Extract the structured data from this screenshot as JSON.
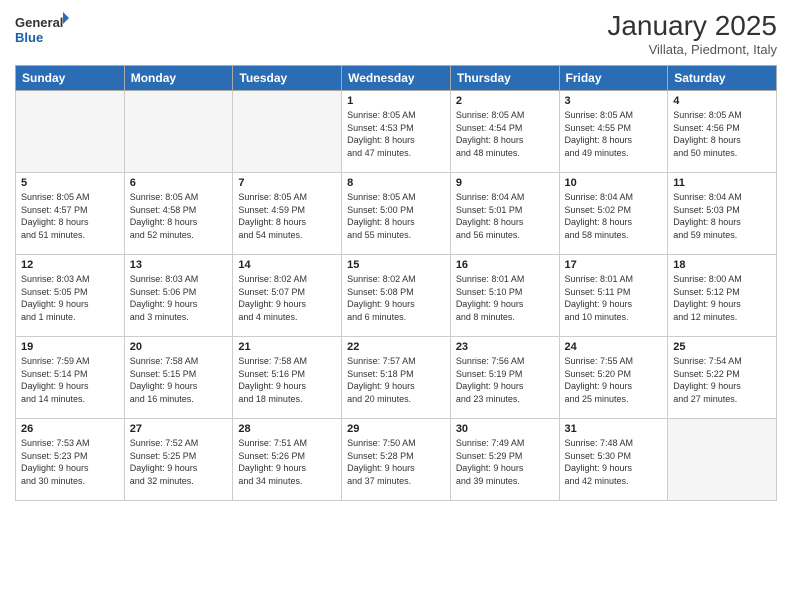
{
  "logo": {
    "general": "General",
    "blue": "Blue"
  },
  "header": {
    "title": "January 2025",
    "location": "Villata, Piedmont, Italy"
  },
  "weekdays": [
    "Sunday",
    "Monday",
    "Tuesday",
    "Wednesday",
    "Thursday",
    "Friday",
    "Saturday"
  ],
  "weeks": [
    [
      {
        "date": "",
        "info": ""
      },
      {
        "date": "",
        "info": ""
      },
      {
        "date": "",
        "info": ""
      },
      {
        "date": "1",
        "info": "Sunrise: 8:05 AM\nSunset: 4:53 PM\nDaylight: 8 hours\nand 47 minutes."
      },
      {
        "date": "2",
        "info": "Sunrise: 8:05 AM\nSunset: 4:54 PM\nDaylight: 8 hours\nand 48 minutes."
      },
      {
        "date": "3",
        "info": "Sunrise: 8:05 AM\nSunset: 4:55 PM\nDaylight: 8 hours\nand 49 minutes."
      },
      {
        "date": "4",
        "info": "Sunrise: 8:05 AM\nSunset: 4:56 PM\nDaylight: 8 hours\nand 50 minutes."
      }
    ],
    [
      {
        "date": "5",
        "info": "Sunrise: 8:05 AM\nSunset: 4:57 PM\nDaylight: 8 hours\nand 51 minutes."
      },
      {
        "date": "6",
        "info": "Sunrise: 8:05 AM\nSunset: 4:58 PM\nDaylight: 8 hours\nand 52 minutes."
      },
      {
        "date": "7",
        "info": "Sunrise: 8:05 AM\nSunset: 4:59 PM\nDaylight: 8 hours\nand 54 minutes."
      },
      {
        "date": "8",
        "info": "Sunrise: 8:05 AM\nSunset: 5:00 PM\nDaylight: 8 hours\nand 55 minutes."
      },
      {
        "date": "9",
        "info": "Sunrise: 8:04 AM\nSunset: 5:01 PM\nDaylight: 8 hours\nand 56 minutes."
      },
      {
        "date": "10",
        "info": "Sunrise: 8:04 AM\nSunset: 5:02 PM\nDaylight: 8 hours\nand 58 minutes."
      },
      {
        "date": "11",
        "info": "Sunrise: 8:04 AM\nSunset: 5:03 PM\nDaylight: 8 hours\nand 59 minutes."
      }
    ],
    [
      {
        "date": "12",
        "info": "Sunrise: 8:03 AM\nSunset: 5:05 PM\nDaylight: 9 hours\nand 1 minute."
      },
      {
        "date": "13",
        "info": "Sunrise: 8:03 AM\nSunset: 5:06 PM\nDaylight: 9 hours\nand 3 minutes."
      },
      {
        "date": "14",
        "info": "Sunrise: 8:02 AM\nSunset: 5:07 PM\nDaylight: 9 hours\nand 4 minutes."
      },
      {
        "date": "15",
        "info": "Sunrise: 8:02 AM\nSunset: 5:08 PM\nDaylight: 9 hours\nand 6 minutes."
      },
      {
        "date": "16",
        "info": "Sunrise: 8:01 AM\nSunset: 5:10 PM\nDaylight: 9 hours\nand 8 minutes."
      },
      {
        "date": "17",
        "info": "Sunrise: 8:01 AM\nSunset: 5:11 PM\nDaylight: 9 hours\nand 10 minutes."
      },
      {
        "date": "18",
        "info": "Sunrise: 8:00 AM\nSunset: 5:12 PM\nDaylight: 9 hours\nand 12 minutes."
      }
    ],
    [
      {
        "date": "19",
        "info": "Sunrise: 7:59 AM\nSunset: 5:14 PM\nDaylight: 9 hours\nand 14 minutes."
      },
      {
        "date": "20",
        "info": "Sunrise: 7:58 AM\nSunset: 5:15 PM\nDaylight: 9 hours\nand 16 minutes."
      },
      {
        "date": "21",
        "info": "Sunrise: 7:58 AM\nSunset: 5:16 PM\nDaylight: 9 hours\nand 18 minutes."
      },
      {
        "date": "22",
        "info": "Sunrise: 7:57 AM\nSunset: 5:18 PM\nDaylight: 9 hours\nand 20 minutes."
      },
      {
        "date": "23",
        "info": "Sunrise: 7:56 AM\nSunset: 5:19 PM\nDaylight: 9 hours\nand 23 minutes."
      },
      {
        "date": "24",
        "info": "Sunrise: 7:55 AM\nSunset: 5:20 PM\nDaylight: 9 hours\nand 25 minutes."
      },
      {
        "date": "25",
        "info": "Sunrise: 7:54 AM\nSunset: 5:22 PM\nDaylight: 9 hours\nand 27 minutes."
      }
    ],
    [
      {
        "date": "26",
        "info": "Sunrise: 7:53 AM\nSunset: 5:23 PM\nDaylight: 9 hours\nand 30 minutes."
      },
      {
        "date": "27",
        "info": "Sunrise: 7:52 AM\nSunset: 5:25 PM\nDaylight: 9 hours\nand 32 minutes."
      },
      {
        "date": "28",
        "info": "Sunrise: 7:51 AM\nSunset: 5:26 PM\nDaylight: 9 hours\nand 34 minutes."
      },
      {
        "date": "29",
        "info": "Sunrise: 7:50 AM\nSunset: 5:28 PM\nDaylight: 9 hours\nand 37 minutes."
      },
      {
        "date": "30",
        "info": "Sunrise: 7:49 AM\nSunset: 5:29 PM\nDaylight: 9 hours\nand 39 minutes."
      },
      {
        "date": "31",
        "info": "Sunrise: 7:48 AM\nSunset: 5:30 PM\nDaylight: 9 hours\nand 42 minutes."
      },
      {
        "date": "",
        "info": ""
      }
    ]
  ]
}
